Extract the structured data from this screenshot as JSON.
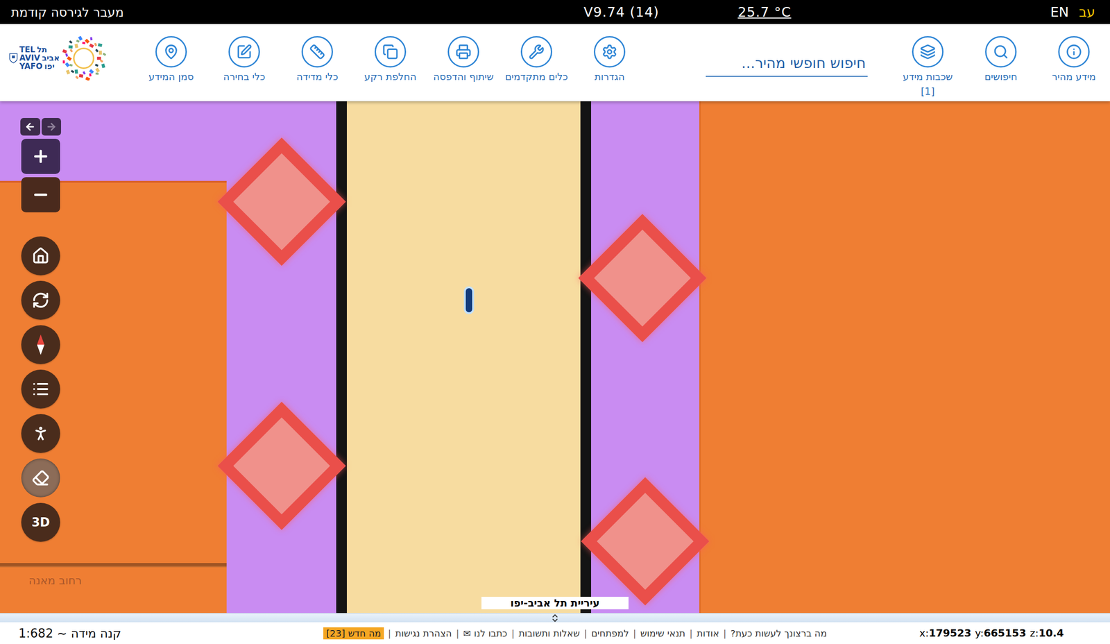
{
  "top_bar": {
    "previous_version": "מעבר לגירסה קודמת",
    "version": "V9.74 (14)",
    "temperature": "25.7 °C",
    "languages": [
      {
        "label": "EN",
        "selected": false
      },
      {
        "label": "עב",
        "selected": true
      }
    ]
  },
  "logo": {
    "rows": [
      {
        "latin": "TEL",
        "hebrew": "תל"
      },
      {
        "latin": "AVIV",
        "hebrew": "אביב"
      },
      {
        "latin": "YAFO",
        "hebrew": "יפו"
      }
    ]
  },
  "toolbar": {
    "primary": [
      {
        "label": "מידע מהיר"
      },
      {
        "label": "חיפושים"
      },
      {
        "label": "שכבות מידע",
        "badge": "[1]"
      }
    ],
    "search": {
      "placeholder": "חיפוש חופשי מהיר..."
    },
    "tools": [
      {
        "label": "הגדרות"
      },
      {
        "label": "כלים מתקדמים"
      },
      {
        "label": "שיתוף והדפסה"
      },
      {
        "label": "החלפת רקע"
      },
      {
        "label": "כלי מדידה"
      },
      {
        "label": "כלי בחירה"
      },
      {
        "label": "סמן המידע"
      }
    ]
  },
  "map_controls": {
    "history": [
      {
        "kind": "back",
        "disabled": false
      },
      {
        "kind": "forward",
        "disabled": true
      }
    ],
    "zoom": [
      {
        "kind": "zoom-in"
      },
      {
        "kind": "zoom-out"
      }
    ],
    "buttons": [
      {
        "kind": "home",
        "dimmed": false
      },
      {
        "kind": "refresh",
        "dimmed": false
      },
      {
        "kind": "compass",
        "dimmed": false
      },
      {
        "kind": "list",
        "dimmed": false
      },
      {
        "kind": "person",
        "dimmed": false
      },
      {
        "kind": "eraser",
        "dimmed": true
      },
      {
        "kind": "3d",
        "label": "3D",
        "dimmed": false
      }
    ]
  },
  "map": {
    "street_label": "רחוב מאנה",
    "watermark": "עיריית תל אביב-יפו"
  },
  "status_bar": {
    "scale": "קנה מידה ~ 1:682",
    "links": [
      "מה ברצונך לעשות כעת?",
      "אודות",
      "תנאי שימוש",
      "למפתחים",
      "שאלות ותשובות",
      "כתבו לנו ✉",
      "הצהרת נגישות"
    ],
    "separator": "|",
    "whats_new": "מה חדש [23]",
    "coordinates": [
      {
        "label": "x:",
        "value": "179523"
      },
      {
        "label": "y:",
        "value": "665153"
      },
      {
        "label": "z:",
        "value": "10.4"
      }
    ]
  }
}
